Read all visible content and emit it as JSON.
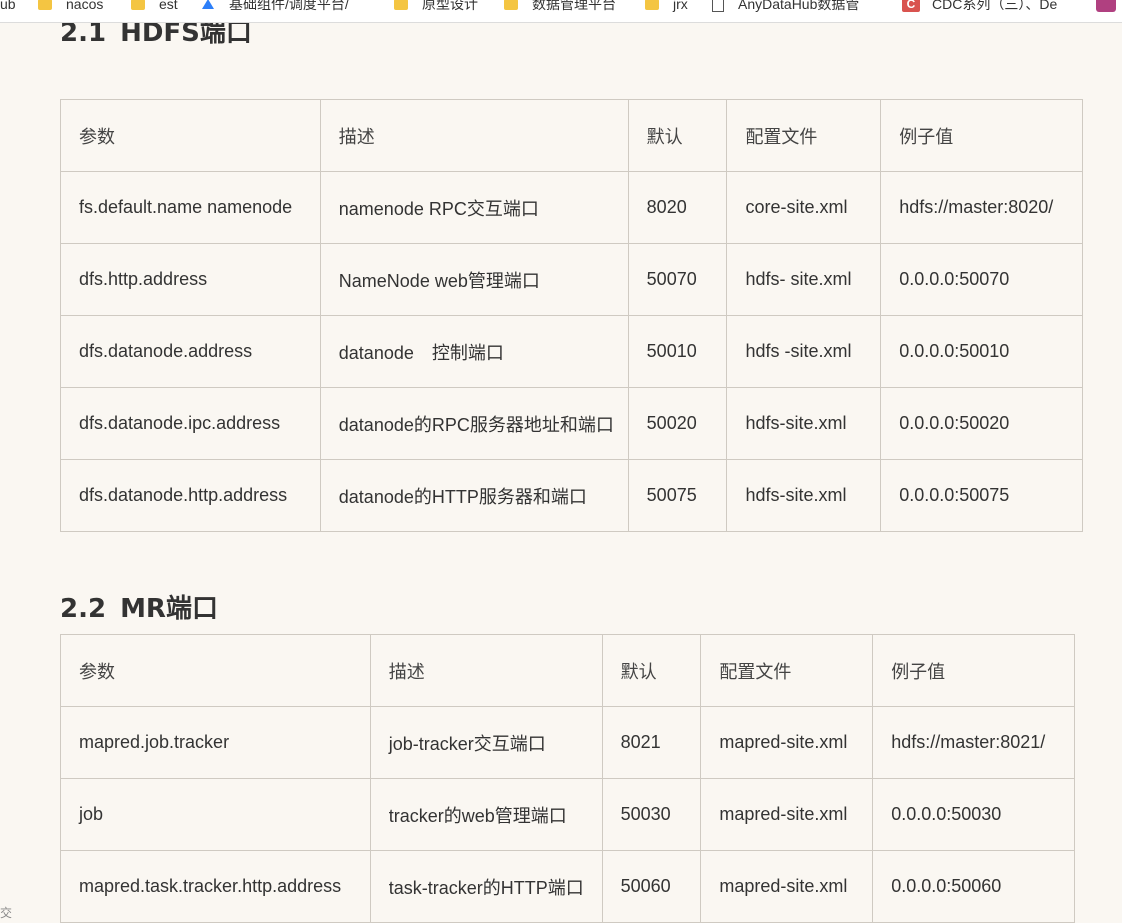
{
  "bookmarks": [
    {
      "label": "ub",
      "icon": "none"
    },
    {
      "label": "nacos",
      "icon": "folder-icon"
    },
    {
      "label": "est",
      "icon": "folder-icon"
    },
    {
      "label": "基础组件/调度平台/",
      "icon": "blue-logo-icon"
    },
    {
      "label": "原型设计",
      "icon": "folder-icon"
    },
    {
      "label": "数据管理平台",
      "icon": "folder-icon"
    },
    {
      "label": "jrx",
      "icon": "folder-icon"
    },
    {
      "label": "AnyDataHub数据管",
      "icon": "page-icon"
    },
    {
      "label": "CDC系列（三）、De",
      "icon": "csdn-icon"
    }
  ],
  "sections": [
    {
      "number": "2.1",
      "title": "HDFS端口",
      "columns": [
        "参数",
        "描述",
        "默认",
        "配置文件",
        "例子值"
      ],
      "rows": [
        [
          "fs.default.name namenode",
          "namenode RPC交互端口",
          "8020",
          "core-site.xml",
          "hdfs://master:8020/"
        ],
        [
          "dfs.http.address",
          "NameNode web管理端口",
          "50070",
          "hdfs- site.xml",
          "0.0.0.0:50070"
        ],
        [
          "dfs.datanode.address",
          "datanode　控制端口",
          "50010",
          "hdfs -site.xml",
          "0.0.0.0:50010"
        ],
        [
          "dfs.datanode.ipc.address",
          "datanode的RPC服务器地址和端口",
          "50020",
          "hdfs-site.xml",
          "0.0.0.0:50020"
        ],
        [
          "dfs.datanode.http.address",
          "datanode的HTTP服务器和端口",
          "50075",
          "hdfs-site.xml",
          "0.0.0.0:50075"
        ]
      ]
    },
    {
      "number": "2.2",
      "title": "MR端口",
      "columns": [
        "参数",
        "描述",
        "默认",
        "配置文件",
        "例子值"
      ],
      "rows": [
        [
          "mapred.job.tracker",
          "job-tracker交互端口",
          "8021",
          "mapred-site.xml",
          "hdfs://master:8021/"
        ],
        [
          "job",
          "tracker的web管理端口",
          "50030",
          "mapred-site.xml",
          "0.0.0.0:50030"
        ],
        [
          "mapred.task.tracker.http.address",
          "task-tracker的HTTP端口",
          "50060",
          "mapred-site.xml",
          "0.0.0.0:50060"
        ]
      ]
    }
  ],
  "side_mark": "交"
}
